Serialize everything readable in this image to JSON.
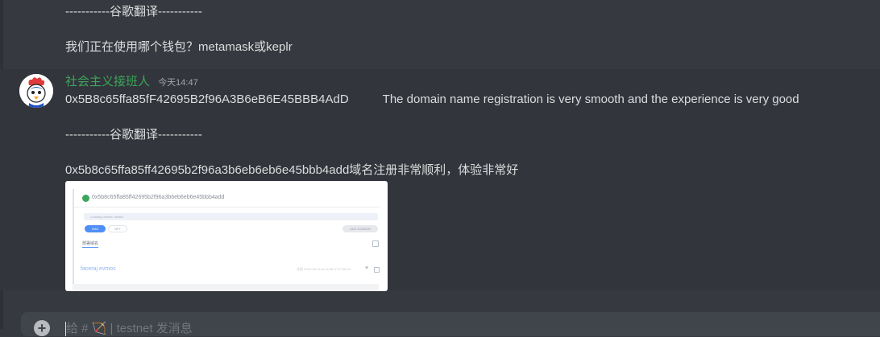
{
  "messages": {
    "prev_translation_sep": "-----------谷歌翻译-----------",
    "prev_translation": "我们正在使用哪个钱包？metamask或keplr",
    "author": "社会主义接班人",
    "timestamp": "今天14:47",
    "line1_address": "0x5B8c65ffa85fF42695B2f96A3B6eB6E45BBB4AdD",
    "line1_text": "The domain name registration is very smooth and the experience is very good",
    "translation_sep": "-----------谷歌翻译-----------",
    "translation": "0x5b8c65ffa85ff42695b2f96a3b6eb6eb6e45bbb4add域名注册非常顺利，体验非常好"
  },
  "attachment": {
    "title": "0x5b8c65ffa85ff42695b2f96a3b6eb6eb6e45bbb4add",
    "search_text": "Loading domain details",
    "pill_a": "GAS",
    "pill_b": "NFT",
    "pill_c": "ADD DOMAIN",
    "tag": "部署域名",
    "link": "faceraj evmos",
    "meta": "注册 2023-08-16 at 16:28 UTC+08:00"
  },
  "composer": {
    "placeholder": "给 # 🏹 | testnet 发消息"
  },
  "icons": {
    "plus": "plus-circle-icon",
    "heart": "heart-icon",
    "copy": "copy-icon"
  },
  "colors": {
    "background": "#36393f",
    "author": "#3ba55c",
    "link": "#8fb3f2"
  }
}
